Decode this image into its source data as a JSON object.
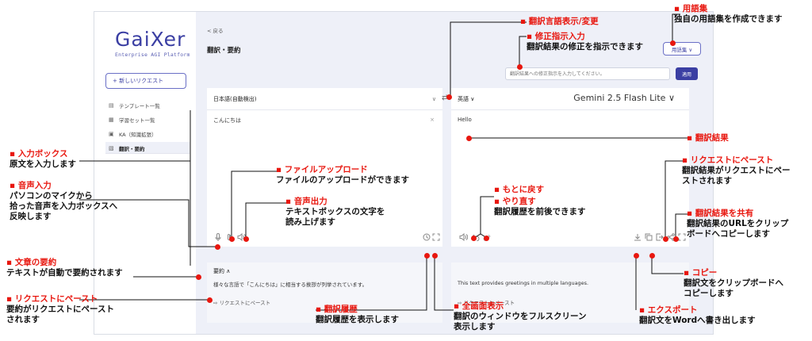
{
  "sidebar": {
    "logo_text": "GaiXer",
    "logo_sub": "Enterprise AGI Platform",
    "new_request": "+ 新しいリクエスト",
    "items": [
      {
        "icon": "template-icon",
        "glyph": "▤",
        "label": "テンプレート一覧"
      },
      {
        "icon": "dataset-icon",
        "glyph": "▦",
        "label": "学習セット一覧"
      },
      {
        "icon": "ka-icon",
        "glyph": "▣",
        "label": "KA（知識拡張）"
      },
      {
        "icon": "translate-icon",
        "glyph": "▧",
        "label": "翻訳・要約"
      }
    ]
  },
  "main": {
    "back": "< 戻る",
    "title": "翻訳・要約",
    "glossary_btn": "用語集 ∨",
    "instruction_placeholder": "翻訳結果への修正指示を入力してください。",
    "apply_btn": "適用",
    "source_lang": "日本語(自動検出)",
    "source_lang_caret": "∨",
    "swap": "⇄",
    "target_lang": "英語 ∨",
    "model": "Gemini 2.5 Flash Lite  ∨",
    "source_text": "こんにちは",
    "clear": "×",
    "target_text": "Hello",
    "summary_header": "要約 ∧",
    "summary_text": "様々な言語で「こんにちは」に相当する挨拶が列挙されています。",
    "summary_paste": "⇨ リクエストにペースト",
    "translation_summary": "This text provides greetings in multiple languages.",
    "translation_paste": "⇨ リクエストにペースト"
  },
  "annotations": {
    "lang": {
      "h": "翻訳言語表示/変更"
    },
    "instr": {
      "h": "修正指示入力",
      "d": "翻訳結果の修正を指示できます"
    },
    "gloss": {
      "h": "用語集",
      "d": "独自の用語集を作成できます"
    },
    "input": {
      "h": "入力ボックス",
      "d": "原文を入力します"
    },
    "voice": {
      "h": "音声入力",
      "d1": "パソコンのマイクから",
      "d2": "拾った音声を入力ボックスへ",
      "d3": "反映します"
    },
    "file": {
      "h": "ファイルアップロード",
      "d": "ファイルのアップロードができます"
    },
    "speaker": {
      "h": "音声出力",
      "d1": "テキストボックスの文字を",
      "d2": "読み上げます"
    },
    "result": {
      "h": "翻訳結果"
    },
    "paste_right": {
      "h": "リクエストにペースト",
      "d1": "翻訳結果がリクエストにペー",
      "d2": "ストされます"
    },
    "undo": {
      "h": "もとに戻す"
    },
    "redo": {
      "h": "やり直す",
      "d": "翻訳履歴を前後できます"
    },
    "share": {
      "h": "翻訳結果を共有",
      "d1": "翻訳結果のURLをクリップ",
      "d2": "ボードへコピーします"
    },
    "summary": {
      "h": "文章の要約",
      "d": "テキストが自動で要約されます"
    },
    "paste_left": {
      "h": "リクエストにペースト",
      "d1": "要約がリクエストにペースト",
      "d2": "されます"
    },
    "history": {
      "h": "翻訳履歴",
      "d": "翻訳履歴を表示します"
    },
    "full": {
      "h": "全画面表示",
      "d1": "翻訳のウィンドウをフルスクリーン",
      "d2": "表示します"
    },
    "copy": {
      "h": "コピー",
      "d1": "翻訳文をクリップボードへ",
      "d2": "コピーします"
    },
    "export": {
      "h": "エクスポート",
      "d": "翻訳文をWordへ書き出します"
    }
  },
  "colors": {
    "accent": "#3b3fa3",
    "annotation": "#e8170f"
  }
}
